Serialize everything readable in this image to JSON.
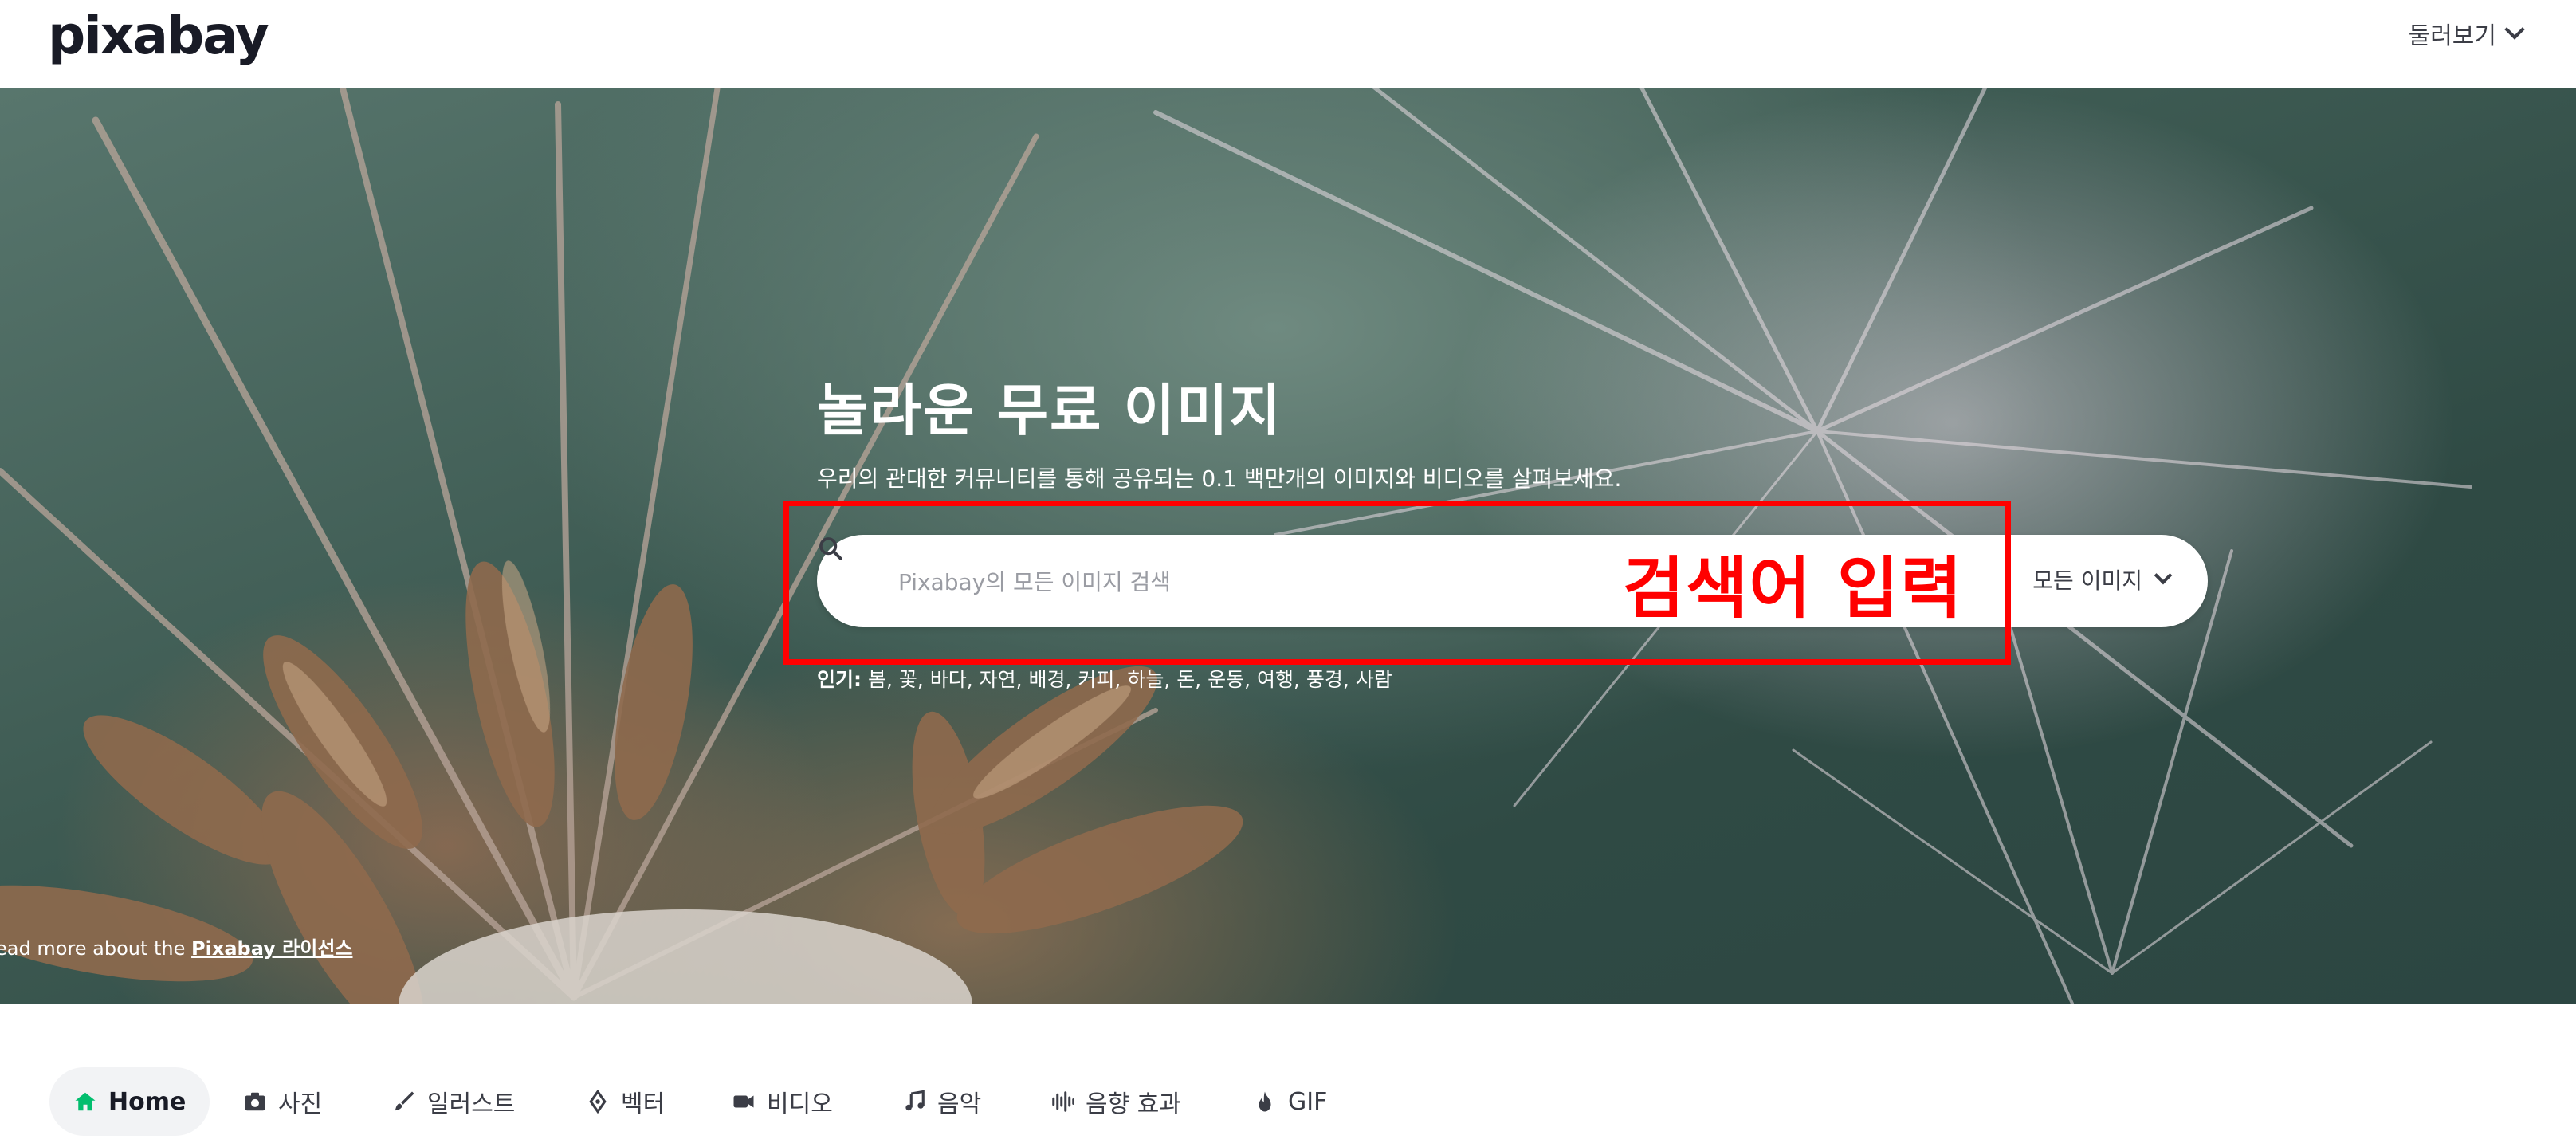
{
  "header": {
    "logo": "pixabay",
    "explore_label": "둘러보기"
  },
  "hero": {
    "title": "놀라운 무료 이미지",
    "subtitle": "우리의 관대한 커뮤니티를 통해 공유되는 0.1 백만개의 이미지와 비디오를 살펴보세요.",
    "search": {
      "placeholder": "Pixabay의 모든 이미지 검색",
      "value": "",
      "filter_label": "모든 이미지"
    },
    "popular": {
      "label": "인기:",
      "terms": "봄, 꽃, 바다, 자연, 배경, 커피, 하늘, 돈, 운동, 여행, 풍경, 사람"
    },
    "license": {
      "prefix": "ead more about the",
      "link": "Pixabay 라이선스"
    }
  },
  "annotation": {
    "label": "검색어 입력",
    "color": "#ff0000"
  },
  "nav": {
    "items": [
      {
        "label": "Home",
        "icon": "home-icon",
        "active": true
      },
      {
        "label": "사진",
        "icon": "camera-icon"
      },
      {
        "label": "일러스트",
        "icon": "brush-icon"
      },
      {
        "label": "벡터",
        "icon": "pen-nib-icon"
      },
      {
        "label": "비디오",
        "icon": "video-camera-icon"
      },
      {
        "label": "음악",
        "icon": "music-note-icon"
      },
      {
        "label": "음향 효과",
        "icon": "waveform-icon"
      },
      {
        "label": "GIF",
        "icon": "fire-icon"
      }
    ]
  },
  "colors": {
    "accent": "#02be6e",
    "annotation": "#ff0000",
    "text": "#191b26"
  }
}
